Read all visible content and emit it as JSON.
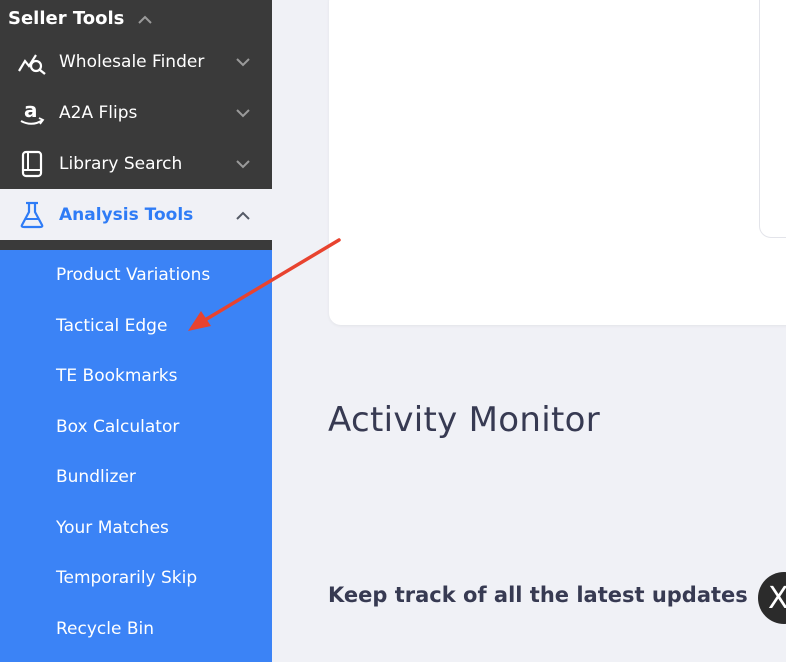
{
  "sidebar": {
    "header": {
      "label": "Seller Tools"
    },
    "items": [
      {
        "label": "Wholesale Finder",
        "icon": "chart-search-icon"
      },
      {
        "label": "A2A Flips",
        "icon": "amazon-icon"
      },
      {
        "label": "Library Search",
        "icon": "book-icon"
      },
      {
        "label": "Analysis Tools",
        "icon": "flask-icon",
        "active": true
      }
    ],
    "submenu": [
      {
        "label": "Product Variations"
      },
      {
        "label": "Tactical Edge"
      },
      {
        "label": "TE Bookmarks"
      },
      {
        "label": "Box Calculator"
      },
      {
        "label": "Bundlizer"
      },
      {
        "label": "Your Matches"
      },
      {
        "label": "Temporarily Skip"
      },
      {
        "label": "Recycle Bin"
      }
    ]
  },
  "main": {
    "title": "Activity Monitor",
    "subtitle": "Keep track of all the latest updates",
    "close_glyph": "X"
  },
  "colors": {
    "sidebar_bg": "#3a3a3a",
    "submenu_bg": "#3b83f6",
    "active_text": "#2f7cf6",
    "page_bg": "#f0f1f6",
    "annotation_arrow": "#e8432f"
  }
}
